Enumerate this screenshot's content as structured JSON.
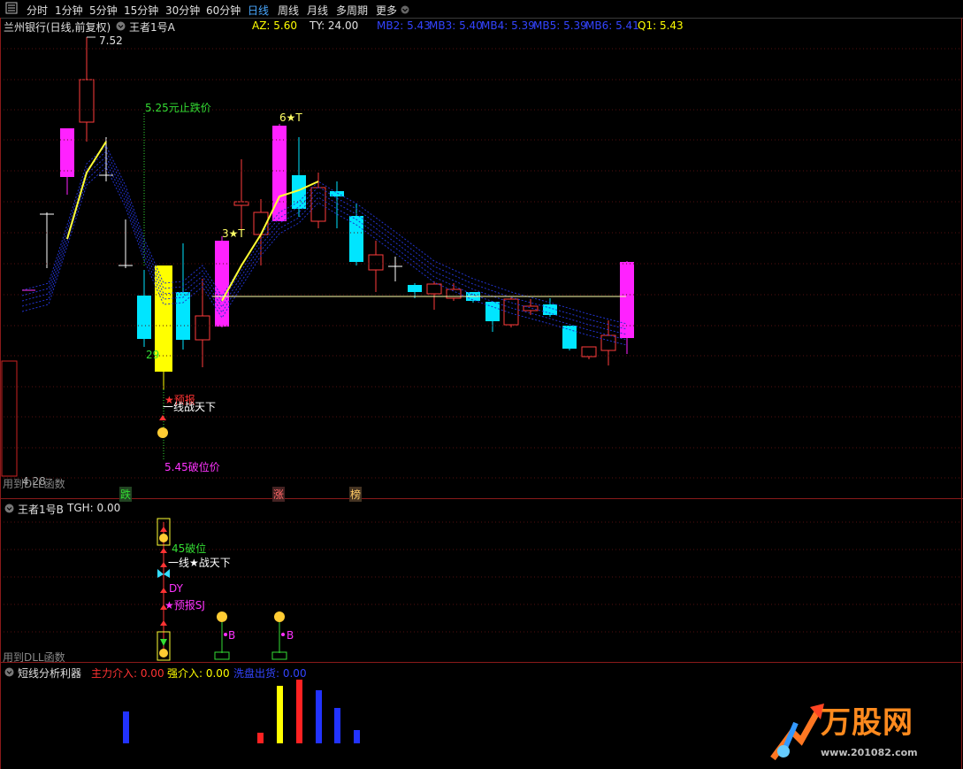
{
  "toolbar": {
    "menu_icon": "menu-icon",
    "items": [
      "分时",
      "1分钟",
      "5分钟",
      "15分钟",
      "30分钟",
      "60分钟",
      "日线",
      "周线",
      "月线",
      "多周期",
      "更多"
    ],
    "active": "日线"
  },
  "main_panel": {
    "stock_title": "兰州银行(日线,前复权)",
    "indicator": "王者1号A",
    "az_label": "AZ: 5.60",
    "ty_label": "TY: 24.00",
    "mb2": "MB2: 5.43",
    "mb3": "MB3: 5.40",
    "mb4": "MB4: 5.39",
    "mb5": "MB5: 5.39",
    "mb6": "MB6: 5.41",
    "q1": "Q1: 5.43",
    "high_label": "7.52",
    "stop_price_label": "5.25元止跌价",
    "star6": "6★T",
    "star3": "3★T",
    "num29": "29",
    "forecast": "★预报",
    "one_line": "一线战天下",
    "break_price": "5.45破位价",
    "footer_text": "用到DLL函数",
    "low_label": "4.28",
    "badge_die": "跌",
    "badge_zhang": "涨",
    "badge_bang": "榜"
  },
  "panel_b": {
    "indicator": "王者1号B",
    "tgh": "TGH: 0.00",
    "break_label": "45破位",
    "one_line": "一线★战天下",
    "dy": "DY",
    "forecast_sj": "★预报SJ",
    "b1": "B",
    "b2": "B",
    "footer_text": "用到DLL函数"
  },
  "panel_c": {
    "indicator": "短线分析利器",
    "main_in": "主力介入: 0.00",
    "strong_in": "强介入: 0.00",
    "wash_out": "洗盘出货: 0.00"
  },
  "watermark": {
    "brand": "万股网",
    "url": "www.201082.com"
  },
  "colors": {
    "up": "#ff3b3b",
    "down": "#00e5ff",
    "magenta": "#ff22ff",
    "yellow": "#ffff00",
    "bg": "#000000",
    "separator": "#8a1a1a"
  }
}
